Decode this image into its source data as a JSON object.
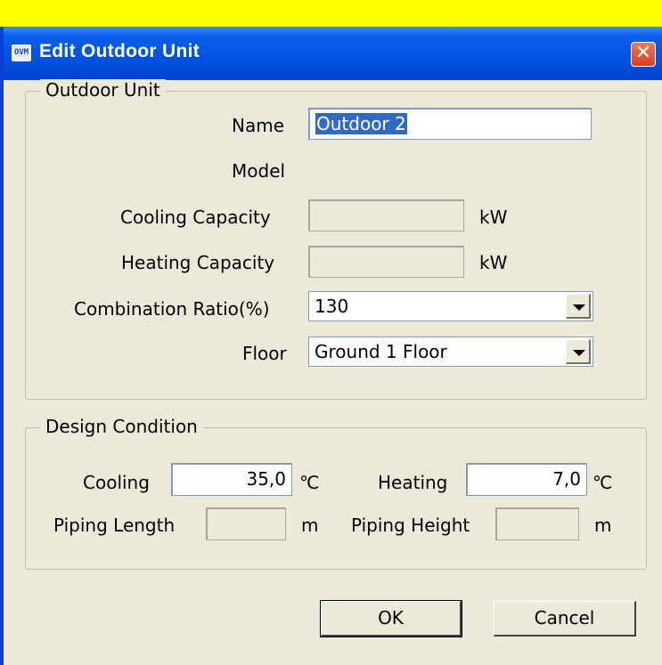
{
  "window": {
    "title": "Edit Outdoor Unit",
    "icon_label": "OVM",
    "close_glyph": "✕"
  },
  "outdoor_unit": {
    "group_label": "Outdoor Unit",
    "name_label": "Name",
    "name_value": "Outdoor  2",
    "model_label": "Model",
    "cooling_capacity_label": "Cooling Capacity",
    "cooling_capacity_value": "",
    "cooling_capacity_unit": "kW",
    "heating_capacity_label": "Heating Capacity",
    "heating_capacity_value": "",
    "heating_capacity_unit": "kW",
    "combination_ratio_label": "Combination Ratio(%)",
    "combination_ratio_value": "130",
    "floor_label": "Floor",
    "floor_value": "Ground  1 Floor"
  },
  "design_condition": {
    "group_label": "Design Condition",
    "cooling_label": "Cooling",
    "cooling_value": "35,0",
    "cooling_unit": "℃",
    "heating_label": "Heating",
    "heating_value": "7,0",
    "heating_unit": "℃",
    "piping_length_label": "Piping Length",
    "piping_length_value": "",
    "piping_length_unit": "m",
    "piping_height_label": "Piping Height",
    "piping_height_value": "",
    "piping_height_unit": "m"
  },
  "buttons": {
    "ok_label": "OK",
    "cancel_label": "Cancel"
  },
  "colors": {
    "titlebar": "#0054e3",
    "dialog_bg": "#ece9d8",
    "selection": "#316ac5",
    "top_strip": "#ffff00"
  }
}
